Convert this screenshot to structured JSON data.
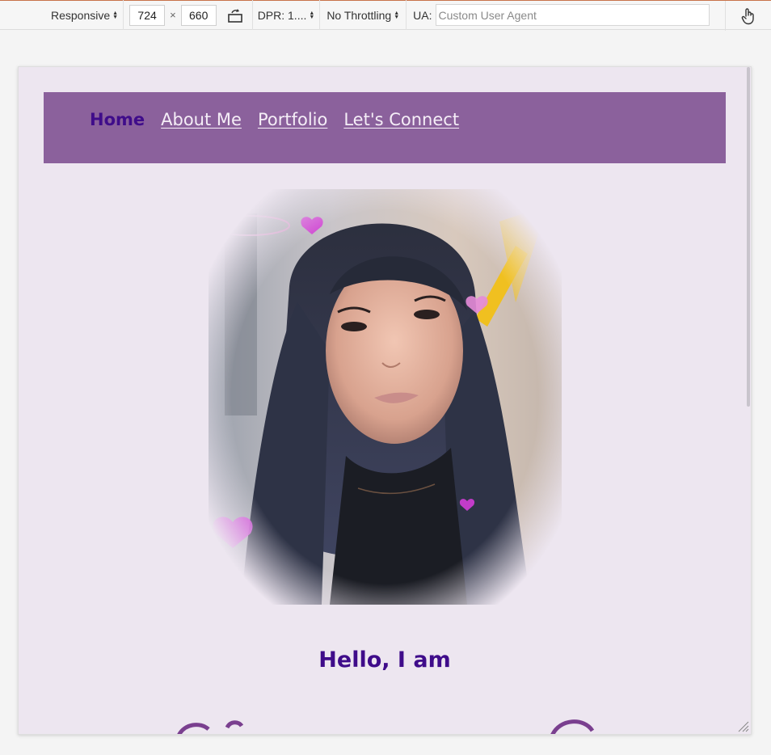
{
  "toolbar": {
    "device_mode": "Responsive",
    "width": "724",
    "height": "660",
    "times": "×",
    "dpr": "DPR: 1....",
    "throttling": "No Throttling",
    "ua_label": "UA:",
    "ua_placeholder": "Custom User Agent"
  },
  "nav": {
    "items": [
      {
        "label": "Home",
        "active": true
      },
      {
        "label": "About Me"
      },
      {
        "label": "Portfolio"
      },
      {
        "label": "Let's Connect"
      }
    ]
  },
  "hero": {
    "greeting": "Hello, I am"
  },
  "colors": {
    "nav_bg": "#8b619c",
    "accent": "#3f0c8a",
    "page_bg": "#ede6f0"
  }
}
